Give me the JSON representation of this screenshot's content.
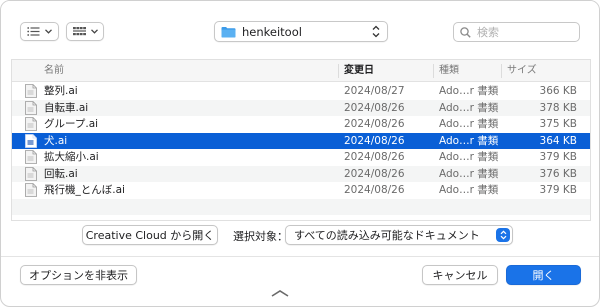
{
  "toolbar": {
    "view_icon": "list-view-icon",
    "group_icon": "grid-view-icon",
    "location": "henkeitool",
    "search_placeholder": "検索"
  },
  "columns": {
    "name": "名前",
    "date": "変更日",
    "kind": "種類",
    "size": "サイズ"
  },
  "files": [
    {
      "name": "整列.ai",
      "date": "2024/08/27",
      "kind": "Ado…r 書類",
      "size": "366 KB",
      "selected": false
    },
    {
      "name": "自転車.ai",
      "date": "2024/08/26",
      "kind": "Ado…r 書類",
      "size": "378 KB",
      "selected": false
    },
    {
      "name": "グループ.ai",
      "date": "2024/08/26",
      "kind": "Ado…r 書類",
      "size": "375 KB",
      "selected": false
    },
    {
      "name": "犬.ai",
      "date": "2024/08/26",
      "kind": "Ado…r 書類",
      "size": "364 KB",
      "selected": true
    },
    {
      "name": "拡大縮小.ai",
      "date": "2024/08/26",
      "kind": "Ado…r 書類",
      "size": "379 KB",
      "selected": false
    },
    {
      "name": "回転.ai",
      "date": "2024/08/26",
      "kind": "Ado…r 書類",
      "size": "376 KB",
      "selected": false
    },
    {
      "name": "飛行機_とんぼ.ai",
      "date": "2024/08/26",
      "kind": "Ado…r 書類",
      "size": "379 KB",
      "selected": false
    }
  ],
  "options": {
    "cc_button": "Creative Cloud から開く",
    "filter_label": "選択対象：",
    "filter_value": "すべての読み込み可能なドキュメント"
  },
  "footer": {
    "hide_options": "オプションを非表示",
    "cancel": "キャンセル",
    "open": "開く"
  },
  "colors": {
    "accent": "#1a73e8",
    "selection": "#0a5fd6",
    "folder": "#3b9bea"
  }
}
